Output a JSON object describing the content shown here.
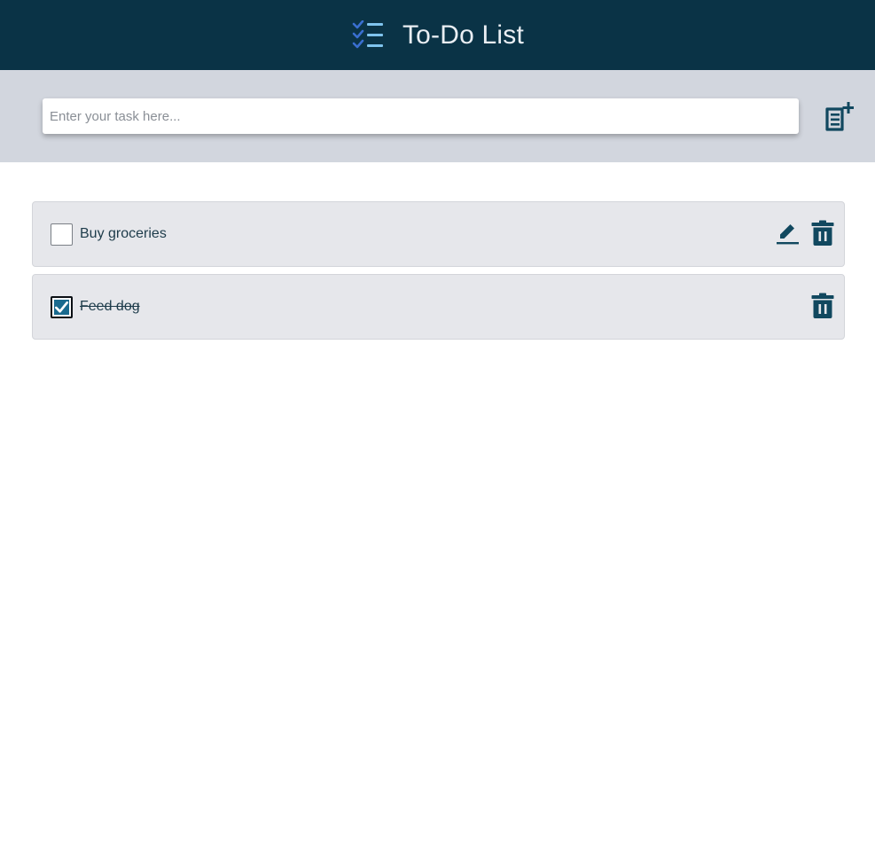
{
  "header": {
    "title": "To-Do List",
    "logo_icon": "checklist-icon"
  },
  "input": {
    "placeholder": "Enter your task here...",
    "value": "",
    "add_icon": "add-note-icon"
  },
  "tasks": [
    {
      "label": "Buy groceries",
      "completed": false,
      "actions": [
        "edit",
        "delete"
      ]
    },
    {
      "label": "Feed dog",
      "completed": true,
      "actions": [
        "delete"
      ]
    }
  ],
  "colors": {
    "header_bg": "#0a3346",
    "accent": "#11485f",
    "checkbox_checked": "#1a6a8e",
    "input_bar_bg": "#d2d6de",
    "task_bg": "#e6e7eb"
  }
}
